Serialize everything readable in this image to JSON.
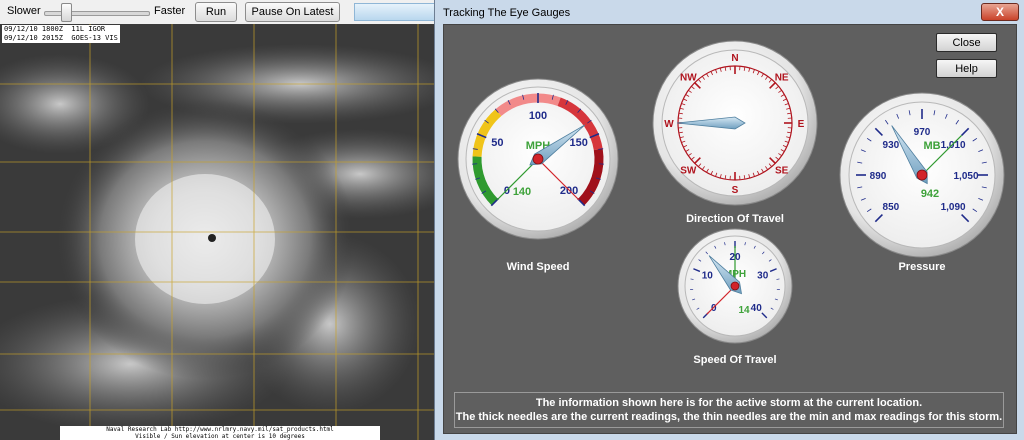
{
  "toolbar": {
    "slower_label": "Slower",
    "faster_label": "Faster",
    "run_label": "Run",
    "pause_label": "Pause On Latest"
  },
  "satellite": {
    "caption_line1": "09/12/10 1800Z  11L IGOR",
    "caption_line2": "09/12/10 2015Z  GOES-13 VIS",
    "footer_line1": "Naval Research Lab http://www.nrlmry.navy.mil/sat_products.html",
    "footer_line2": "Visible / Sun elevation at center is 10 degrees"
  },
  "window": {
    "title": "Tracking The Eye Gauges",
    "close_glyph": "X",
    "close_button": "Close",
    "help_button": "Help"
  },
  "gauges": {
    "wind_speed": {
      "label": "Wind Speed",
      "unit": "MPH",
      "ticks": [
        "0",
        "50",
        "100",
        "150",
        "200"
      ],
      "value": "140",
      "current": 140,
      "min": 0,
      "max": 200
    },
    "direction": {
      "label": "Direction Of Travel",
      "points": [
        "N",
        "NE",
        "E",
        "SE",
        "S",
        "SW",
        "W",
        "NW"
      ],
      "heading": "W"
    },
    "pressure": {
      "label": "Pressure",
      "unit": "MB",
      "ticks": [
        "850",
        "890",
        "930",
        "970",
        "1,010",
        "1,050",
        "1,090"
      ],
      "value": "942",
      "current": 942
    },
    "speed_of_travel": {
      "label": "Speed Of Travel",
      "unit": "MPH",
      "ticks": [
        "0",
        "10",
        "20",
        "30",
        "40"
      ],
      "value": "14",
      "current": 14
    }
  },
  "info": {
    "line1": "The information shown here is for the active storm at the current location.",
    "line2": "The thick needles are the current readings, the thin needles are the min and max readings for this storm."
  },
  "colors": {
    "panel": "#5f5f5f",
    "needle": "#9fc3dc",
    "dial_navy": "#1f2b8a",
    "dial_red": "#b0141e",
    "value_green": "#3ea23a"
  }
}
